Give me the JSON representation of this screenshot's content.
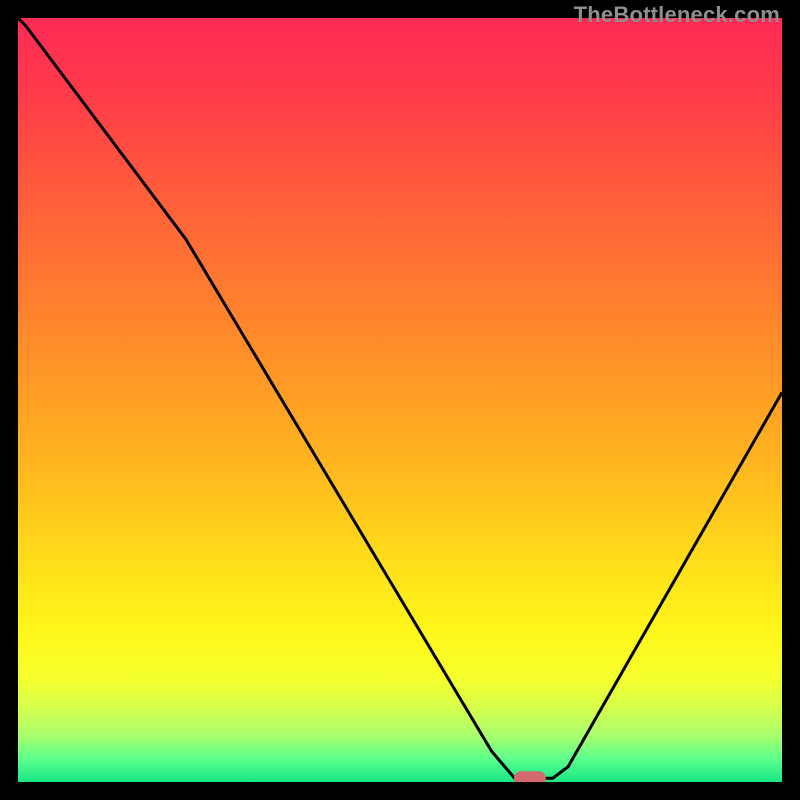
{
  "watermark": {
    "text": "TheBottleneck.com"
  },
  "colors": {
    "frame": "#000000",
    "curve": "#000000",
    "marker": "#d46a6f",
    "gradient_stops": [
      {
        "offset": 0.0,
        "color": "#ff2a55"
      },
      {
        "offset": 0.1,
        "color": "#ff3b4a"
      },
      {
        "offset": 0.22,
        "color": "#ff5a3c"
      },
      {
        "offset": 0.35,
        "color": "#ff7a30"
      },
      {
        "offset": 0.48,
        "color": "#ff9a26"
      },
      {
        "offset": 0.6,
        "color": "#ffba1e"
      },
      {
        "offset": 0.72,
        "color": "#ffe01a"
      },
      {
        "offset": 0.8,
        "color": "#fff61a"
      },
      {
        "offset": 0.86,
        "color": "#f7ff2a"
      },
      {
        "offset": 0.9,
        "color": "#d9ff4a"
      },
      {
        "offset": 0.94,
        "color": "#a8ff6e"
      },
      {
        "offset": 0.97,
        "color": "#5bff8c"
      },
      {
        "offset": 1.0,
        "color": "#17e884"
      }
    ]
  },
  "chart_data": {
    "type": "line",
    "title": "",
    "xlabel": "",
    "ylabel": "",
    "xlim": [
      0,
      100
    ],
    "ylim": [
      0,
      100
    ],
    "marker_at_x": 67,
    "x": [
      0,
      1,
      22,
      62,
      65,
      70,
      72,
      100
    ],
    "values": [
      100,
      99,
      71,
      4,
      0.5,
      0.5,
      2,
      51
    ],
    "comment": "y scales from 0 (bottom/green) to 100 (top/red). Curve descends from top-left, kinks near x≈22,y≈71, reaches ≈0 around x≈65–70, then rises to ≈51 at x=100."
  }
}
